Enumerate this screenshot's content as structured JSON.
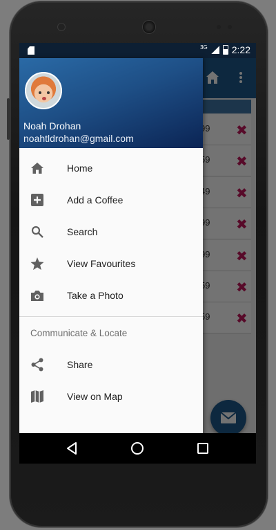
{
  "status_bar": {
    "network": "3G",
    "time": "2:22"
  },
  "background_app": {
    "prices": [
      "99",
      "59",
      "49",
      "99",
      "99",
      "59",
      "59"
    ],
    "delete_symbol": "✖"
  },
  "drawer": {
    "user_name": "Noah Drohan",
    "user_email": "noahtldrohan@gmail.com",
    "primary_items": [
      {
        "label": "Home",
        "icon": "home-icon"
      },
      {
        "label": "Add a Coffee",
        "icon": "add-box-icon"
      },
      {
        "label": "Search",
        "icon": "search-icon"
      },
      {
        "label": "View Favourites",
        "icon": "star-icon"
      },
      {
        "label": "Take a Photo",
        "icon": "camera-icon"
      }
    ],
    "section_title": "Communicate & Locate",
    "secondary_items": [
      {
        "label": "Share",
        "icon": "share-icon"
      },
      {
        "label": "View on Map",
        "icon": "map-icon"
      }
    ]
  },
  "colors": {
    "toolbar": "#1d5a8c",
    "drawer_header_start": "#2a6aa6",
    "drawer_header_end": "#0b2454",
    "delete_accent": "#c2185b",
    "icon_grey": "#616161"
  }
}
